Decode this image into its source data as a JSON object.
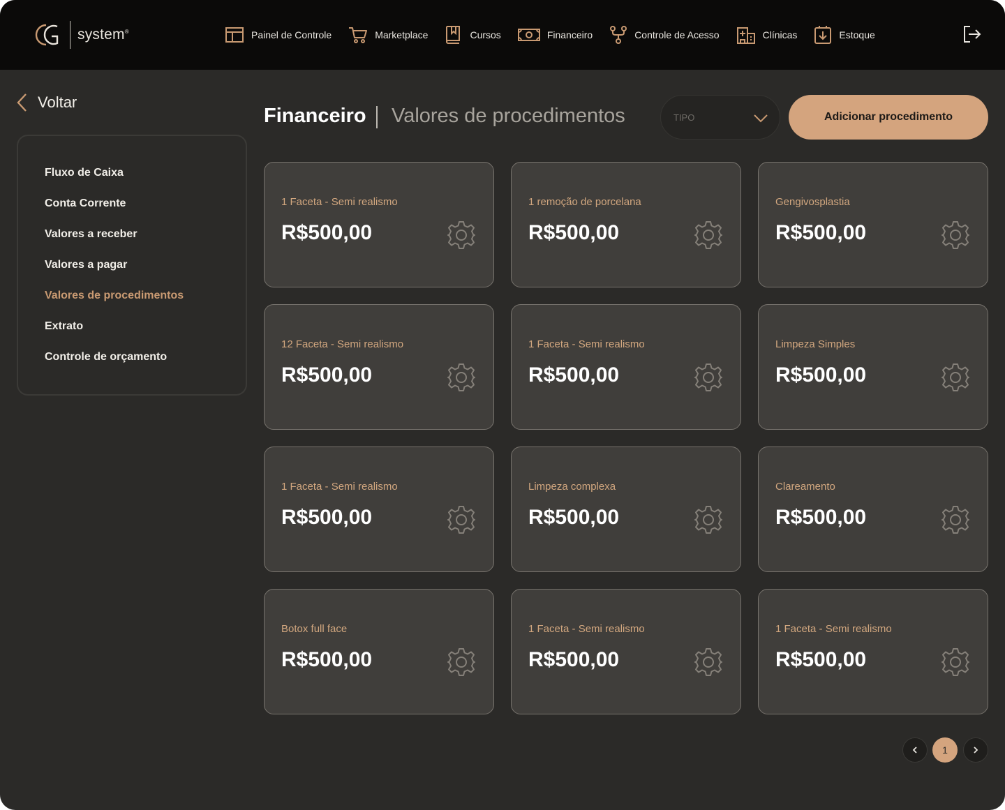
{
  "brand": {
    "name": "system",
    "reg": "®"
  },
  "nav": {
    "items": [
      {
        "label": "Painel de Controle",
        "icon": "dashboard-icon"
      },
      {
        "label": "Marketplace",
        "icon": "cart-icon"
      },
      {
        "label": "Cursos",
        "icon": "book-icon"
      },
      {
        "label": "Financeiro",
        "icon": "money-icon"
      },
      {
        "label": "Controle de Acesso",
        "icon": "fork-icon"
      },
      {
        "label": "Clínicas",
        "icon": "building-icon"
      },
      {
        "label": "Estoque",
        "icon": "download-box-icon"
      }
    ],
    "logout_icon": "logout-icon"
  },
  "back": {
    "label": "Voltar"
  },
  "sidebar": {
    "items": [
      {
        "label": "Fluxo de Caixa",
        "active": false
      },
      {
        "label": "Conta Corrente",
        "active": false
      },
      {
        "label": "Valores a receber",
        "active": false
      },
      {
        "label": "Valores a pagar",
        "active": false
      },
      {
        "label": "Valores de procedimentos",
        "active": true
      },
      {
        "label": "Extrato",
        "active": false
      },
      {
        "label": "Controle de orçamento",
        "active": false
      }
    ]
  },
  "header": {
    "title": "Financeiro",
    "subtitle": "Valores de procedimentos",
    "type_select": {
      "placeholder": "TIPO"
    },
    "add_button": "Adicionar procedimento"
  },
  "procedures": [
    {
      "name": "1 Faceta - Semi realismo",
      "value": "R$500,00"
    },
    {
      "name": "1 remoção de porcelana",
      "value": "R$500,00"
    },
    {
      "name": "Gengivosplastia",
      "value": "R$500,00"
    },
    {
      "name": "12 Faceta - Semi realismo",
      "value": "R$500,00"
    },
    {
      "name": "1 Faceta - Semi realismo",
      "value": "R$500,00"
    },
    {
      "name": "Limpeza Simples",
      "value": "R$500,00"
    },
    {
      "name": "1 Faceta - Semi realismo",
      "value": "R$500,00"
    },
    {
      "name": "Limpeza complexa",
      "value": "R$500,00"
    },
    {
      "name": "Clareamento",
      "value": "R$500,00"
    },
    {
      "name": "Botox full face",
      "value": "R$500,00"
    },
    {
      "name": "1 Faceta - Semi realismo",
      "value": "R$500,00"
    },
    {
      "name": "1 Faceta - Semi realismo",
      "value": "R$500,00"
    }
  ],
  "pagination": {
    "current": "1"
  },
  "colors": {
    "accent": "#d4a47e",
    "accent_text": "#d2a77f",
    "background": "#2b2a28",
    "topbar": "#0b0a09",
    "card": "#403e3b"
  }
}
